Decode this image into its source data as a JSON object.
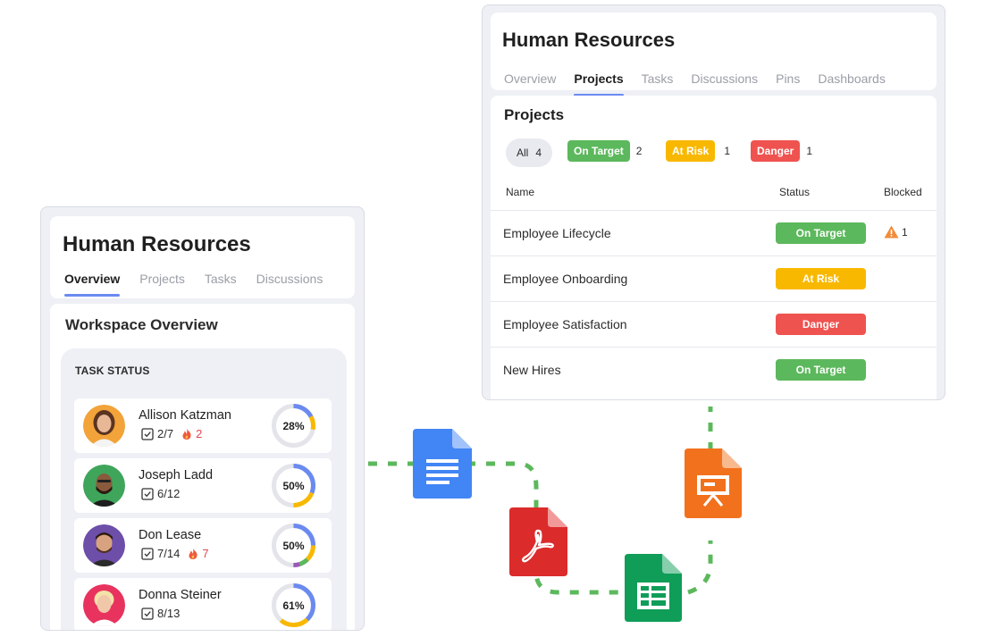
{
  "left_card": {
    "title": "Human Resources",
    "tabs": [
      {
        "label": "Overview",
        "active": true
      },
      {
        "label": "Projects",
        "active": false
      },
      {
        "label": "Tasks",
        "active": false
      },
      {
        "label": "Discussions",
        "active": false
      }
    ],
    "section_title": "Workspace Overview",
    "task_status_label": "TASK STATUS",
    "people": [
      {
        "name": "Allison Katzman",
        "tasks": "2/7",
        "fire": "2",
        "percent": "28%",
        "progress": 0.28
      },
      {
        "name": "Joseph Ladd",
        "tasks": "6/12",
        "fire": "",
        "percent": "50%",
        "progress": 0.5
      },
      {
        "name": "Don Lease",
        "tasks": "7/14",
        "fire": "7",
        "percent": "50%",
        "progress": 0.5
      },
      {
        "name": "Donna Steiner",
        "tasks": "8/13",
        "fire": "",
        "percent": "61%",
        "progress": 0.61
      }
    ]
  },
  "right_card": {
    "title": "Human Resources",
    "tabs": [
      {
        "label": "Overview",
        "active": false
      },
      {
        "label": "Projects",
        "active": true
      },
      {
        "label": "Tasks",
        "active": false
      },
      {
        "label": "Discussions",
        "active": false
      },
      {
        "label": "Pins",
        "active": false
      },
      {
        "label": "Dashboards",
        "active": false
      }
    ],
    "section_title": "Projects",
    "filters": {
      "all": {
        "label": "All",
        "count": "4"
      },
      "on_target": {
        "label": "On Target",
        "count": "2"
      },
      "at_risk": {
        "label": "At Risk",
        "count": "1"
      },
      "danger": {
        "label": "Danger",
        "count": "1"
      }
    },
    "columns": {
      "name": "Name",
      "status": "Status",
      "blocked": "Blocked"
    },
    "projects": [
      {
        "name": "Employee Lifecycle",
        "status": "On Target",
        "blocked": "1"
      },
      {
        "name": "Employee Onboarding",
        "status": "At Risk",
        "blocked": ""
      },
      {
        "name": "Employee Satisfaction",
        "status": "Danger",
        "blocked": ""
      },
      {
        "name": "New Hires",
        "status": "On Target",
        "blocked": ""
      }
    ]
  },
  "colors": {
    "on_target": "#5cb85c",
    "at_risk": "#f9b800",
    "danger": "#ef5350",
    "accent": "#6b8af0",
    "connector": "#5cb85c"
  },
  "icons": [
    "google-docs-icon",
    "pdf-icon",
    "google-sheets-icon",
    "google-slides-icon",
    "warning-icon",
    "checkbox-icon",
    "fire-icon"
  ]
}
